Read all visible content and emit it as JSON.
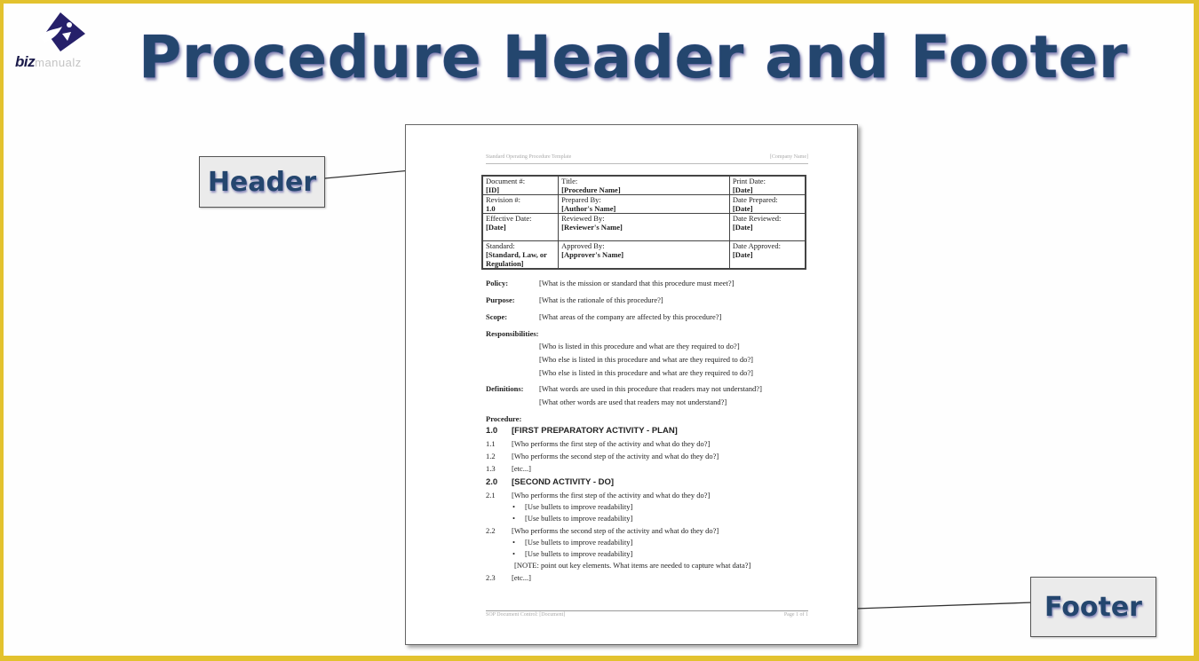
{
  "logo": {
    "brand_bold": "biz",
    "brand_rest": "manualz"
  },
  "title": "Procedure Header and Footer",
  "callouts": {
    "header": "Header",
    "footer": "Footer"
  },
  "doc": {
    "page_header": {
      "left": "Standard Operating Procedure Template",
      "right": "[Company Name]"
    },
    "info_table": [
      [
        {
          "label": "Document #:",
          "value": "[ID]"
        },
        {
          "label": "Title:",
          "value": "[Procedure Name]"
        },
        {
          "label": "Print Date:",
          "value": "[Date]"
        }
      ],
      [
        {
          "label": "Revision #:",
          "value": "1.0"
        },
        {
          "label": "Prepared By:",
          "value": "[Author's Name]"
        },
        {
          "label": "Date Prepared:",
          "value": "[Date]"
        }
      ],
      [
        {
          "label": "Effective Date:",
          "value": "[Date]"
        },
        {
          "label": "Reviewed By:",
          "value": "[Reviewer's Name]"
        },
        {
          "label": "Date Reviewed:",
          "value": "[Date]"
        }
      ],
      [
        {
          "label": "Standard:",
          "value": "[Standard, Law, or Regulation]"
        },
        {
          "label": "Approved By:",
          "value": "[Approver's Name]"
        },
        {
          "label": "Date Approved:",
          "value": "[Date]"
        }
      ]
    ],
    "policy": {
      "label": "Policy:",
      "text": "[What is the mission or standard that this procedure must meet?]"
    },
    "purpose": {
      "label": "Purpose:",
      "text": "[What is the rationale of this procedure?]"
    },
    "scope": {
      "label": "Scope:",
      "text": "[What areas of the company are affected by this procedure?]"
    },
    "responsibilities": {
      "label": "Responsibilities:",
      "items": [
        "[Who is listed in this procedure and what are they required to do?]",
        "[Who else is listed in this procedure and what are they required to do?]",
        "[Who else is listed in this procedure and what are they required to do?]"
      ]
    },
    "definitions": {
      "label": "Definitions:",
      "items": [
        "[What words are used in this procedure that readers may not understand?]",
        "[What other words are used that readers may not understand?]"
      ]
    },
    "procedure": {
      "label": "Procedure:",
      "sections": [
        {
          "num": "1.0",
          "title": "[FIRST PREPARATORY ACTIVITY - PLAN]",
          "steps": [
            {
              "num": "1.1",
              "text": "[Who performs the first step of the activity and what do they do?]"
            },
            {
              "num": "1.2",
              "text": "[Who performs the second step of the activity and what do they do?]"
            },
            {
              "num": "1.3",
              "text": "[etc...]"
            }
          ]
        },
        {
          "num": "2.0",
          "title": "[SECOND ACTIVITY - DO]",
          "steps": [
            {
              "num": "2.1",
              "text": "[Who performs the first step of the activity and what do they do?]",
              "bullets": [
                "[Use bullets to improve readability]",
                "[Use bullets to improve readability]"
              ]
            },
            {
              "num": "2.2",
              "text": "[Who performs the second step of the activity and what do they do?]",
              "bullets": [
                "[Use bullets to improve readability]",
                "[Use bullets to improve readability]"
              ],
              "note": "[NOTE: point out key elements. What items are needed to capture what data?]"
            },
            {
              "num": "2.3",
              "text": "[etc...]"
            }
          ]
        }
      ]
    },
    "page_footer": {
      "left": "SOP Document Control: [Document]",
      "right": "Page 1 of 1"
    }
  }
}
